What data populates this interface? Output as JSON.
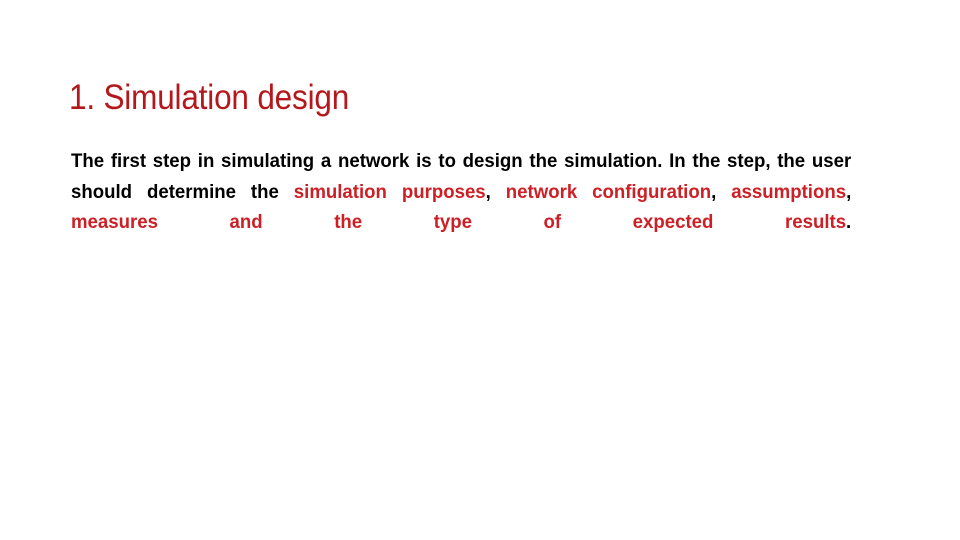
{
  "slide": {
    "title": "1. Simulation design",
    "title_color": "#B5181C",
    "background_color": "#FFFFFF",
    "body": {
      "full_text": "The first step in simulating a network is to design the simulation. In the step, the user should determine the simulation purposes, network configuration, assumptions, measures and the type of expected results.",
      "text_color": "#000000",
      "highlight_color": "#CC2026",
      "segments": [
        {
          "text": "The first step in simulating a network is to design the simulation. In the step, the user should determine the ",
          "style": "normal"
        },
        {
          "text": "simulation purposes",
          "style": "highlight"
        },
        {
          "text": ", ",
          "style": "normal"
        },
        {
          "text": "network configuration",
          "style": "highlight"
        },
        {
          "text": ", ",
          "style": "normal"
        },
        {
          "text": "assumptions",
          "style": "highlight"
        },
        {
          "text": ", ",
          "style": "normal"
        },
        {
          "text": "measures and the type of expected results",
          "style": "highlight"
        },
        {
          "text": ".",
          "style": "normal"
        }
      ],
      "rendered_lines": [
        "The first step in simulating a network is to design the simulation. In",
        "the step, the user should determine the simulation purposes,",
        "network configuration, assumptions, measures and the type of",
        "expected results."
      ]
    }
  }
}
